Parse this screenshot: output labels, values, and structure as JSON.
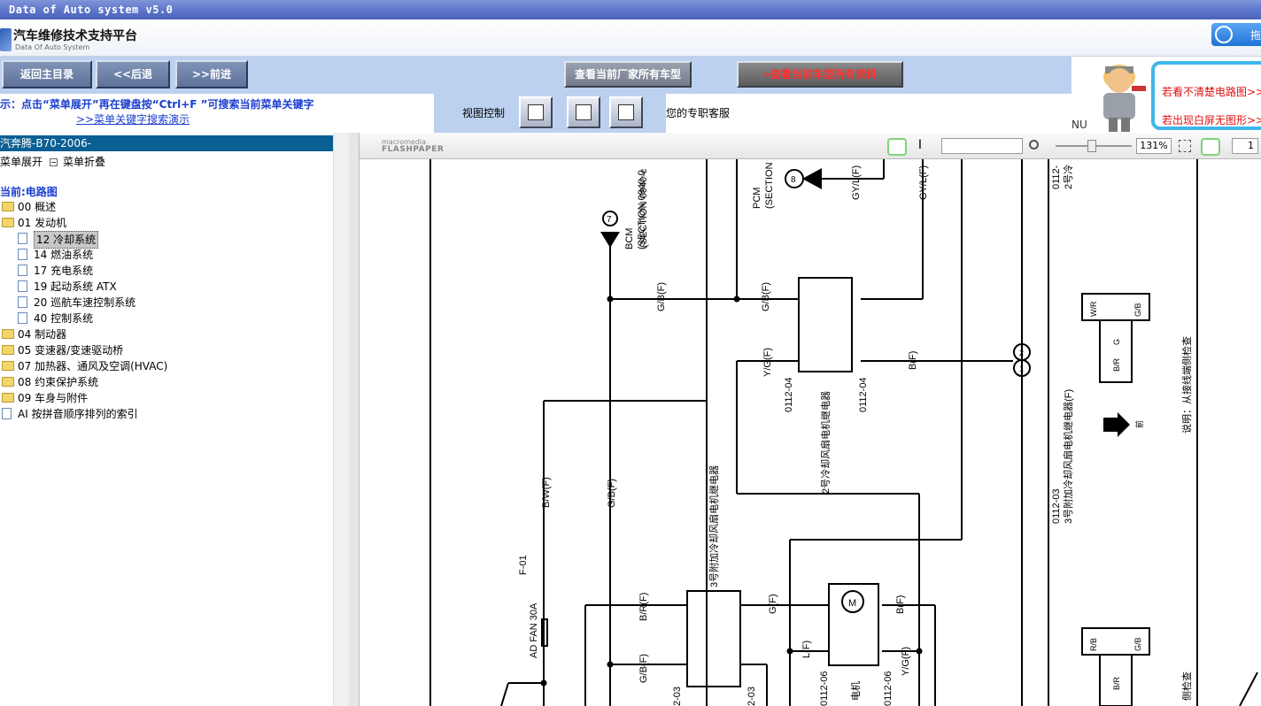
{
  "window": {
    "title": "Data of Auto system v5.0"
  },
  "app": {
    "title": "汽车维修技术支持平台",
    "subtitle": "Data Of Auto System",
    "drag_label": "拖"
  },
  "toolbar": {
    "home": "返回主目录",
    "back": "<<后退",
    "forward": ">>前进",
    "all_models": "查看当前厂家所有车型",
    "all_info": "查看当前车型所有资料"
  },
  "ad": {
    "line1": "若看不清楚电路图>>",
    "line2": "若出现白屏无图形>>",
    "nu": "NU"
  },
  "hint": {
    "text": "示：点击“菜单展开”再在键盘按“Ctrl+F ”可搜索当前菜单关键字",
    "link": ">>菜单关键字搜索演示"
  },
  "view_control": {
    "label": "视图控制"
  },
  "service": "您的专职客服",
  "sidebar": {
    "model": "汽奔腾-B70-2006-",
    "expand": "菜单展开",
    "collapse": "菜单折叠",
    "current": "当前:电路图",
    "items": [
      {
        "label": "00 概述",
        "type": "folder",
        "level": 0
      },
      {
        "label": "01 发动机",
        "type": "folder",
        "level": 0
      },
      {
        "label": "12 冷却系统",
        "type": "doc",
        "level": 1,
        "selected": true
      },
      {
        "label": "14 燃油系统",
        "type": "doc",
        "level": 1
      },
      {
        "label": "17 充电系统",
        "type": "doc",
        "level": 1
      },
      {
        "label": "19 起动系统 ATX",
        "type": "doc",
        "level": 1
      },
      {
        "label": "20 巡航车速控制系统",
        "type": "doc",
        "level": 1
      },
      {
        "label": "40 控制系统",
        "type": "doc",
        "level": 1
      },
      {
        "label": "04 制动器",
        "type": "folder",
        "level": 0
      },
      {
        "label": "05 变速器/变速驱动桥",
        "type": "folder",
        "level": 0
      },
      {
        "label": "07 加热器、通风及空调(HVAC)",
        "type": "folder",
        "level": 0
      },
      {
        "label": "08 约束保护系统",
        "type": "folder",
        "level": 0
      },
      {
        "label": "09 车身与附件",
        "type": "folder",
        "level": 0
      },
      {
        "label": "AI 按拼音顺序排列的索引",
        "type": "doc",
        "level": 0
      }
    ]
  },
  "viewer": {
    "logo_small": "macromedia",
    "logo": "FLASHPAPER",
    "text_tool": "I",
    "zoom": "131%",
    "page": "1"
  },
  "diagram": {
    "labels": {
      "section_0940": "(SECTION 0940-c",
      "bcm": "BCM",
      "bcm_section": "(SECTION 0940-0",
      "pcm": "PCM",
      "pcm_section": "(SECTION",
      "node7": "7",
      "node8": "8",
      "gyl1": "GY/L(F)",
      "gyl2": "GY/L(F)",
      "gb1": "G/B(F)",
      "gb2": "G/B(F)",
      "gb3": "G/B(F)",
      "gb4": "G/B(F)",
      "yg1": "Y/G(F)",
      "yg2": "Y/G(F)",
      "bf1": "B(F)",
      "bf2": "B(F)",
      "bw": "B/W(F)",
      "br": "B/R(F)",
      "gf": "G(F)",
      "lf": "L(F)",
      "fuse_name": "F-01",
      "fuse": "AD FAN 30A",
      "c0112_04a": "0112-04",
      "c0112_04b": "0112-04",
      "c0112_03a": "2-03",
      "c0112_03b": "2-03",
      "c0112_06a": "0112-06",
      "c0112_06b": "0112-06",
      "relay2": "2号冷却风扇电机继电器",
      "relay3": "3号附加冷却风扇电机继电器",
      "motor": "电机",
      "m": "M",
      "right_top_code": "0112-",
      "right_top_text": "2号冷",
      "right_code": "0112-03",
      "right_relay3": "3号附加冷却风扇电机继电器(F)",
      "note": "说明：从接线端侧检查",
      "note2": "侧检查",
      "front": "前",
      "wr": "W/R",
      "gb_pin": "G/B",
      "g_pin": "G",
      "br_pin": "B/R",
      "rb": "R/B",
      "gb_pin2": "G/B",
      "br_pin2": "B/R",
      "node1": "1",
      "node2": "2"
    }
  }
}
